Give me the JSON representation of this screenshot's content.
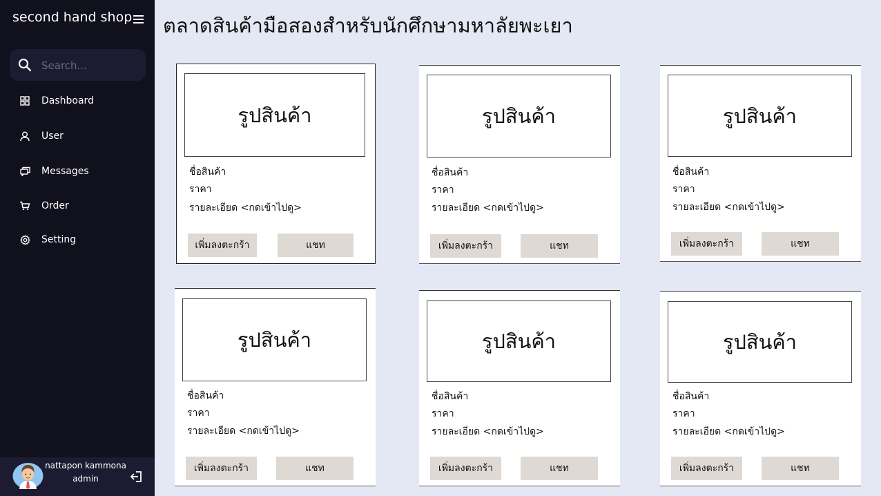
{
  "sidebar": {
    "brand": "second hand shop",
    "search": {
      "placeholder": "Search...",
      "value": ""
    },
    "items": [
      {
        "label": "Dashboard",
        "icon": "grid-icon"
      },
      {
        "label": "User",
        "icon": "user-icon"
      },
      {
        "label": "Messages",
        "icon": "messages-icon"
      },
      {
        "label": "Order",
        "icon": "cart-icon"
      },
      {
        "label": "Setting",
        "icon": "gear-icon"
      }
    ],
    "profile": {
      "name": "nattapon kammona",
      "role": "admin"
    }
  },
  "main": {
    "title": "ตลาดสินค้ามือสองสำหรับนักศึกษามหาลัยพะเยา",
    "products": [
      {
        "image_label": "รูปสินค้า",
        "name": "ชื่อสินค้า",
        "price": "ราคา",
        "detail": "รายละเอียด <กดเข้าไปดู>",
        "cart_label": "เพิ่มลงตะกร้า",
        "chat_label": "แชท"
      },
      {
        "image_label": "รูปสินค้า",
        "name": "ชื่อสินค้า",
        "price": "ราคา",
        "detail": "รายละเอียด <กดเข้าไปดู>",
        "cart_label": "เพิ่มลงตะกร้า",
        "chat_label": "แชท"
      },
      {
        "image_label": "รูปสินค้า",
        "name": "ชื่อสินค้า",
        "price": "ราคา",
        "detail": "รายละเอียด <กดเข้าไปดู>",
        "cart_label": "เพิ่มลงตะกร้า",
        "chat_label": "แชท"
      },
      {
        "image_label": "รูปสินค้า",
        "name": "ชื่อสินค้า",
        "price": "ราคา",
        "detail": "รายละเอียด <กดเข้าไปดู>",
        "cart_label": "เพิ่มลงตะกร้า",
        "chat_label": "แชท"
      },
      {
        "image_label": "รูปสินค้า",
        "name": "ชื่อสินค้า",
        "price": "ราคา",
        "detail": "รายละเอียด <กดเข้าไปดู>",
        "cart_label": "เพิ่มลงตะกร้า",
        "chat_label": "แชท"
      },
      {
        "image_label": "รูปสินค้า",
        "name": "ชื่อสินค้า",
        "price": "ราคา",
        "detail": "รายละเอียด <กดเข้าไปดู>",
        "cart_label": "เพิ่มลงตะกร้า",
        "chat_label": "แชท"
      }
    ]
  },
  "colors": {
    "sidebar_bg": "#11101d",
    "search_bg": "#1d1b31",
    "page_bg": "#e3e8f4",
    "button_bg": "#dedad3"
  }
}
